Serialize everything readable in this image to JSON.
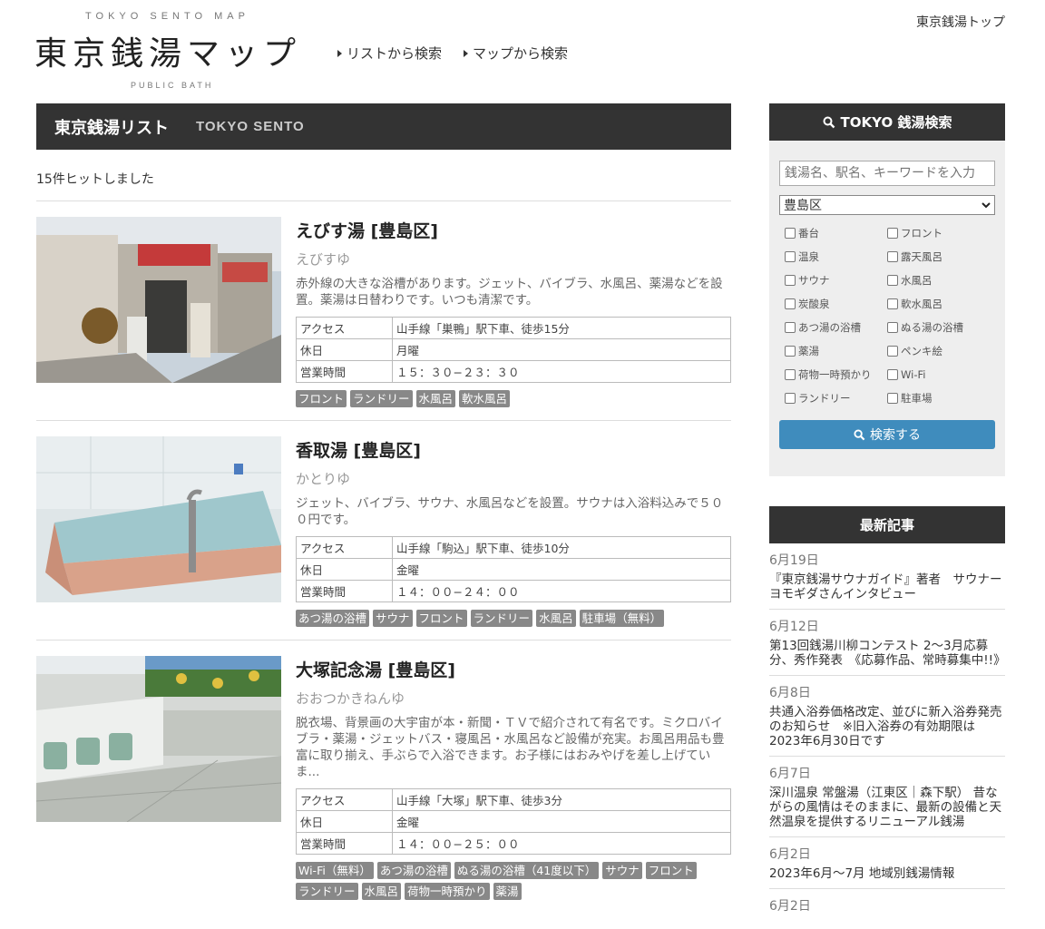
{
  "header": {
    "logo_top": "TOKYO SENTO MAP",
    "logo_main": "東京銭湯マップ",
    "logo_bottom": "PUBLIC BATH",
    "nav": [
      "リストから検索",
      "マップから検索"
    ],
    "top_link": "東京銭湯トップ"
  },
  "list": {
    "heading_jp": "東京銭湯リスト",
    "heading_en": "TOKYO SENTO",
    "hit_count": "15件ヒットしました",
    "spec_labels": {
      "access": "アクセス",
      "closed": "休日",
      "hours": "営業時間"
    },
    "items": [
      {
        "name": "えびす湯 [豊島区]",
        "kana": "えびすゆ",
        "desc": "赤外線の大きな浴槽があります。ジェット、バイブラ、水風呂、薬湯などを設置。薬湯は日替わりです。いつも清潔です。",
        "access": "山手線「巣鴨」駅下車、徒歩15分",
        "closed": "月曜",
        "hours": "１５：３０−２３：３０",
        "tags": [
          "フロント",
          "ランドリー",
          "水風呂",
          "軟水風呂"
        ]
      },
      {
        "name": "香取湯 [豊島区]",
        "kana": "かとりゆ",
        "desc": "ジェット、バイブラ、サウナ、水風呂などを設置。サウナは入浴料込みで５００円です。",
        "access": "山手線「駒込」駅下車、徒歩10分",
        "closed": "金曜",
        "hours": "１４：００−２４：００",
        "tags": [
          "あつ湯の浴槽",
          "サウナ",
          "フロント",
          "ランドリー",
          "水風呂",
          "駐車場（無料）"
        ]
      },
      {
        "name": "大塚記念湯 [豊島区]",
        "kana": "おおつかきねんゆ",
        "desc": "脱衣場、背景画の大宇宙が本・新聞・ＴＶで紹介されて有名です。ミクロバイブラ・薬湯・ジェットバス・寝風呂・水風呂など設備が充実。お風呂用品も豊富に取り揃え、手ぶらで入浴できます。お子様にはおみやげを差し上げていま...",
        "access": "山手線「大塚」駅下車、徒歩3分",
        "closed": "金曜",
        "hours": "１４：００−２５：００",
        "tags": [
          "Wi-Fi（無料）",
          "あつ湯の浴槽",
          "ぬる湯の浴槽（41度以下）",
          "サウナ",
          "フロント",
          "ランドリー",
          "水風呂",
          "荷物一時預かり",
          "薬湯"
        ]
      }
    ]
  },
  "search": {
    "heading": "TOKYO 銭湯検索",
    "keyword_placeholder": "銭湯名、駅名、キーワードを入力",
    "ward_selected": "豊島区",
    "checkboxes": [
      "番台",
      "フロント",
      "温泉",
      "露天風呂",
      "サウナ",
      "水風呂",
      "炭酸泉",
      "軟水風呂",
      "あつ湯の浴槽",
      "ぬる湯の浴槽",
      "薬湯",
      "ペンキ絵",
      "荷物一時預かり",
      "Wi-Fi",
      "ランドリー",
      "駐車場"
    ],
    "button": "検索する"
  },
  "news": {
    "heading": "最新記事",
    "items": [
      {
        "date": "6月19日",
        "title": "『東京銭湯サウナガイド』著者　サウナーヨモギダさんインタビュー"
      },
      {
        "date": "6月12日",
        "title": "第13回銭湯川柳コンテスト 2〜3月応募分、秀作発表　《応募作品、常時募集中!!》"
      },
      {
        "date": "6月8日",
        "title": "共通入浴券価格改定、並びに新入浴券発売のお知らせ　※旧入浴券の有効期限は2023年6月30日です"
      },
      {
        "date": "6月7日",
        "title": "深川温泉 常盤湯（江東区｜森下駅） 昔ながらの風情はそのままに、最新の設備と天然温泉を提供するリニューアル銭湯"
      },
      {
        "date": "6月2日",
        "title": "2023年6月〜7月 地域別銭湯情報"
      },
      {
        "date": "6月2日",
        "title": ""
      }
    ]
  },
  "colors": {
    "dark_bar": "#333333",
    "button_blue": "#3f8cbd",
    "tag_gray": "#888888"
  },
  "icons": {
    "search": "search-icon",
    "nav_arrow": "triangle-right-icon",
    "select": "chevron-down-icon"
  }
}
